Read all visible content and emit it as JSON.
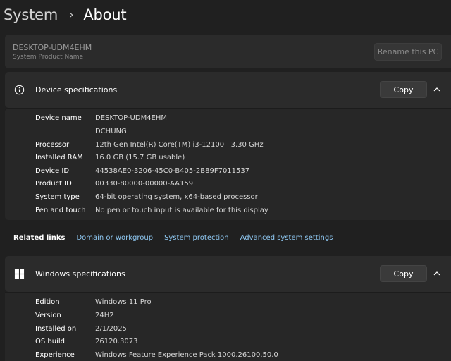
{
  "breadcrumb": {
    "parent": "System",
    "separator": "›",
    "current": "About"
  },
  "pc": {
    "name": "DESKTOP-UDM4EHM",
    "subtitle": "System Product Name",
    "rename_label": "Rename this PC"
  },
  "device": {
    "title": "Device specifications",
    "copy_label": "Copy",
    "rows": [
      {
        "key": "Device name",
        "value": "DESKTOP-UDM4EHM"
      },
      {
        "key": "",
        "value": "DCHUNG"
      },
      {
        "key": "Processor",
        "value": "12th Gen Intel(R) Core(TM) i3-12100   3.30 GHz"
      },
      {
        "key": "Installed RAM",
        "value": "16.0 GB (15.7 GB usable)"
      },
      {
        "key": "Device ID",
        "value": "44538AE0-3206-45C0-B405-2B89F7011537"
      },
      {
        "key": "Product ID",
        "value": "00330-80000-00000-AA159"
      },
      {
        "key": "System type",
        "value": "64-bit operating system, x64-based processor"
      },
      {
        "key": "Pen and touch",
        "value": "No pen or touch input is available for this display"
      }
    ]
  },
  "related": {
    "label": "Related links",
    "links": [
      "Domain or workgroup",
      "System protection",
      "Advanced system settings"
    ]
  },
  "windows": {
    "title": "Windows specifications",
    "copy_label": "Copy",
    "rows": [
      {
        "key": "Edition",
        "value": "Windows 11 Pro"
      },
      {
        "key": "Version",
        "value": "24H2"
      },
      {
        "key": "Installed on",
        "value": "2/1/2025"
      },
      {
        "key": "OS build",
        "value": "26120.3073"
      },
      {
        "key": "Experience",
        "value": "Windows Feature Experience Pack 1000.26100.50.0"
      }
    ]
  },
  "icons": {
    "device_section": "info-icon",
    "windows_section": "windows-logo-icon",
    "collapse": "chevron-up-icon"
  }
}
